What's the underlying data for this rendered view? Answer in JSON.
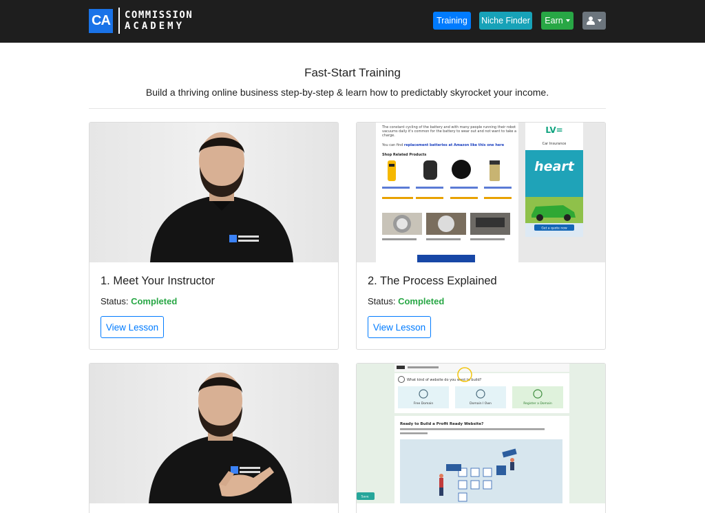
{
  "header": {
    "logo_mark": "CA",
    "logo_line1": "COMMISSION",
    "logo_line2": "ACADEMY",
    "nav": {
      "training": "Training",
      "niche_finder": "Niche Finder",
      "earn": "Earn"
    },
    "icons": {
      "earn_dropdown": "caret-down-icon",
      "user_menu": "user-icon"
    }
  },
  "main": {
    "title": "Fast-Start Training",
    "subtitle": "Build a thriving online business step-by-step & learn how to predictably skyrocket your income."
  },
  "lessons": [
    {
      "title": "1. Meet Your Instructor",
      "status_label": "Status:",
      "status": "Completed",
      "button": "View Lesson"
    },
    {
      "title": "2. The Process Explained",
      "status_label": "Status:",
      "status": "Completed",
      "button": "View Lesson"
    },
    {
      "title": "",
      "status_label": "",
      "status": "",
      "button": ""
    },
    {
      "title": "",
      "status_label": "",
      "status": "",
      "button": ""
    }
  ],
  "thumbnails": {
    "lesson2": {
      "page_text": "The constant cycling of the battery and with many people running their robot vacuums daily it's common for the battery to wear out and not want to take a charge.",
      "link_prefix": "You can find ",
      "link_text": "replacement batteries at Amazon like this one here",
      "shop_heading": "Shop Related Products",
      "ad_brand": "LV=",
      "ad_title": "Car Insurance",
      "ad_heart": "heart",
      "ad_cta": "Get a quote now"
    },
    "lesson4": {
      "question": "What kind of website do you want to build?",
      "options": [
        "Free Domain",
        "Domain I Own",
        "Register a Domain"
      ],
      "heading": "Ready to Build a Profit Ready Website?",
      "save": "Save"
    }
  },
  "colors": {
    "navbar": "#1e1e1e",
    "primary": "#007bff",
    "info": "#17a2b8",
    "success": "#28a745",
    "secondary": "#6c757d"
  }
}
